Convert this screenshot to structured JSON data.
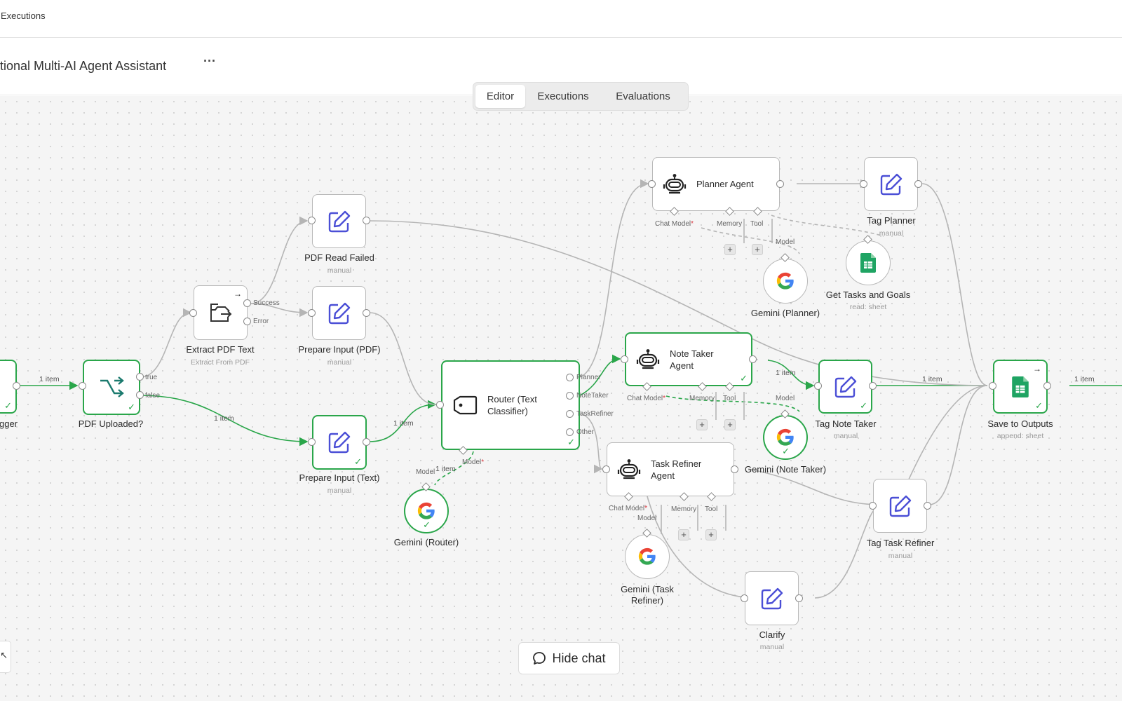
{
  "topbar": {
    "link": "Executions"
  },
  "header": {
    "title": "tional Multi-AI Agent Assistant",
    "more": "···"
  },
  "tabs": [
    {
      "label": "Editor",
      "active": true
    },
    {
      "label": "Executions",
      "active": false
    },
    {
      "label": "Evaluations",
      "active": false
    }
  ],
  "nodes": {
    "trigger": {
      "title": "gger"
    },
    "pdf_uploaded": {
      "title": "PDF Uploaded?"
    },
    "extract_pdf": {
      "title": "Extract PDF Text",
      "sub": "Extract From PDF"
    },
    "pdf_read_failed": {
      "title": "PDF Read Failed",
      "sub": "manual"
    },
    "prepare_pdf": {
      "title": "Prepare Input (PDF)",
      "sub": "manual"
    },
    "prepare_text": {
      "title": "Prepare Input (Text)",
      "sub": "manual"
    },
    "router": {
      "title": "Router (Text Classifier)"
    },
    "gemini_router": {
      "title": "Gemini (Router)"
    },
    "planner": {
      "title": "Planner Agent"
    },
    "gemini_planner": {
      "title": "Gemini (Planner)"
    },
    "tag_planner": {
      "title": "Tag Planner",
      "sub": "manual"
    },
    "get_tasks": {
      "title": "Get Tasks and Goals",
      "sub": "read: sheet"
    },
    "note_taker": {
      "title": "Note Taker Agent"
    },
    "gemini_note": {
      "title": "Gemini (Note Taker)"
    },
    "tag_note": {
      "title": "Tag Note Taker",
      "sub": "manual"
    },
    "task_refiner": {
      "title": "Task Refiner Agent"
    },
    "gemini_task": {
      "title": "Gemini (Task Refiner)"
    },
    "tag_task": {
      "title": "Tag Task Refiner",
      "sub": "manual"
    },
    "clarify": {
      "title": "Clarify",
      "sub": "manual"
    },
    "save_outputs": {
      "title": "Save to Outputs",
      "sub": "append: sheet"
    }
  },
  "branch_labels": {
    "true": "true",
    "false": "false",
    "success": "Success",
    "error": "Error",
    "planner": "Planner",
    "notetaker": "NoteTaker",
    "taskrefiner": "TaskRefiner",
    "other": "Other"
  },
  "port_labels": {
    "chat_model": "Chat Model",
    "memory": "Memory",
    "tool": "Tool",
    "model": "Model",
    "required": "*"
  },
  "edge_labels": {
    "one_item": "1 item"
  },
  "chat": {
    "hide_label": "Hide chat"
  },
  "colors": {
    "success": "#2aa64a",
    "edit_icon": "#4b4fd6",
    "sheets": "#1fa463",
    "canvas": "#f5f5f5"
  },
  "icons": {
    "edit": "pencil-square-icon",
    "robot": "robot-agent-icon",
    "google": "google-g-icon",
    "sheets": "google-sheets-icon",
    "if": "branch-icon",
    "extract": "file-export-icon",
    "tag": "tag-icon",
    "chat": "chat-bubble-icon"
  }
}
